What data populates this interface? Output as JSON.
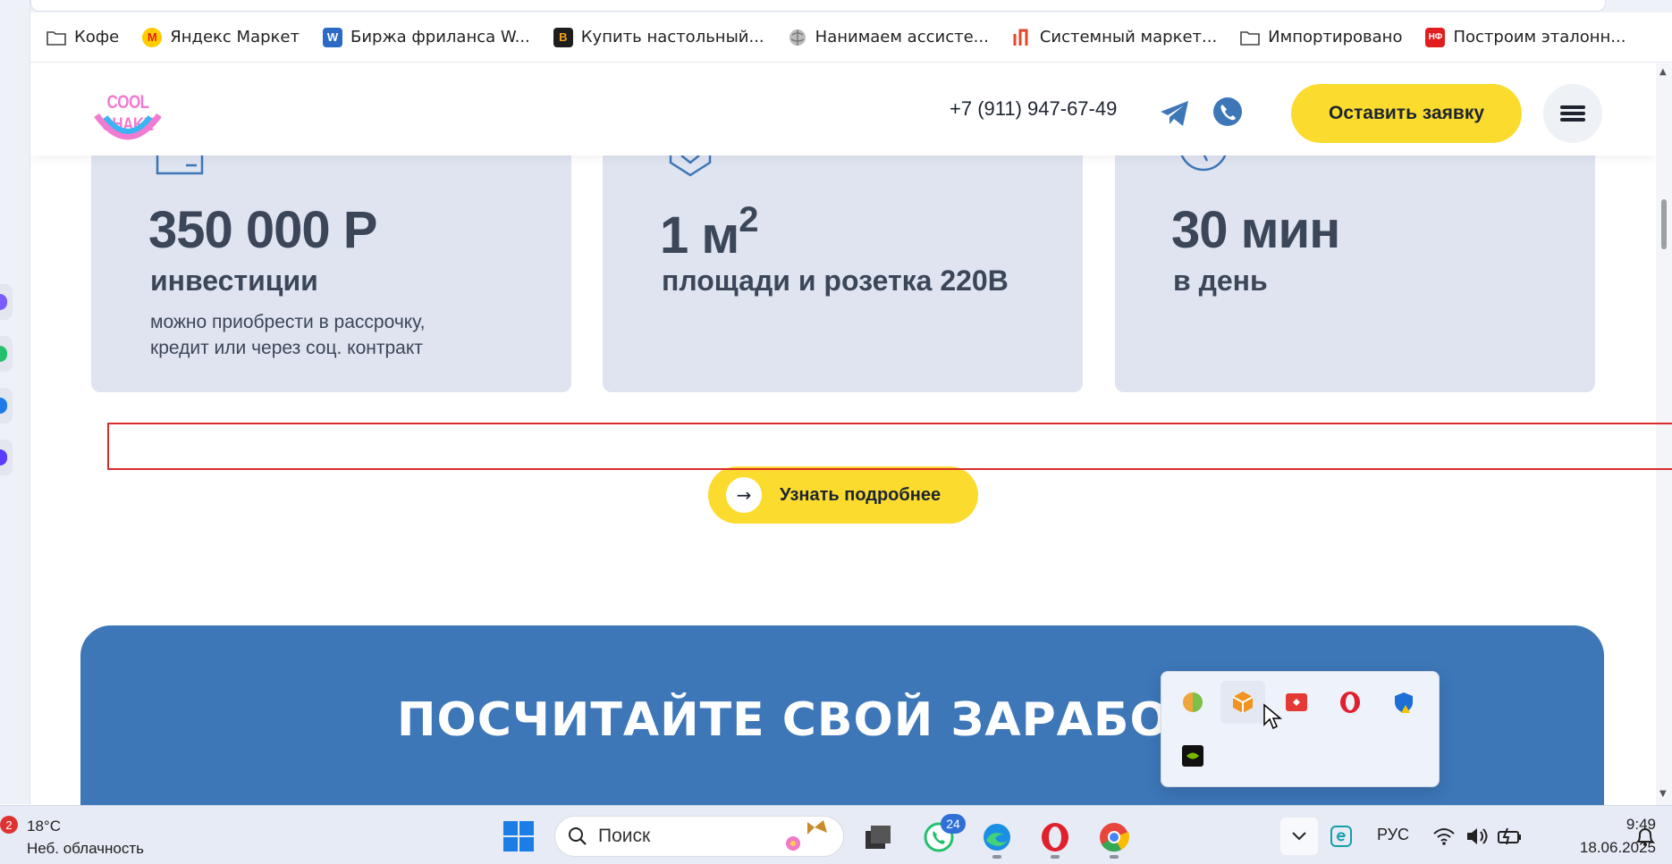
{
  "bookmarks": [
    {
      "label": "Кофе",
      "icon": "folder-icon"
    },
    {
      "label": "Яндекс Маркет",
      "icon": "yandex-market-icon"
    },
    {
      "label": "Биржа фриланса W...",
      "icon": "w-icon"
    },
    {
      "label": "Купить настольный...",
      "icon": "b-icon"
    },
    {
      "label": "Нанимаем ассисте...",
      "icon": "globe-icon"
    },
    {
      "label": "Системный маркет...",
      "icon": "market-icon"
    },
    {
      "label": "Импортировано",
      "icon": "folder-icon"
    },
    {
      "label": "Построим эталонн...",
      "icon": "nf-icon"
    }
  ],
  "header": {
    "logo_text": "COOL SHAKE",
    "phone": "+7 (911) 947-67-49",
    "cta_label": "Оставить заявку"
  },
  "stats": [
    {
      "value": "350 000 Р",
      "sub": "инвестиции",
      "note_line1": "можно приобрести в рассрочку,",
      "note_line2": "кредит или через соц. контракт",
      "icon": "wallet-icon"
    },
    {
      "value": "1 м",
      "sup": "2",
      "sub": "площади и розетка 220В",
      "icon": "box-icon"
    },
    {
      "value": "30 мин",
      "sub": "в день",
      "icon": "clock-icon"
    }
  ],
  "learn_more_label": "Узнать подробнее",
  "calc_title": "ПОСЧИТАЙТЕ СВОЙ ЗАРАБОТО",
  "taskbar": {
    "weather_badge": "2",
    "weather_temp": "18°C",
    "weather_desc": "Неб. облачность",
    "search_placeholder": "Поиск",
    "whatsapp_badge": "24",
    "lang": "РУС",
    "time": "9:49",
    "date": "18.06.2025"
  },
  "colors": {
    "accent_yellow": "#fbdc2e",
    "calc_blue": "#3d77b8",
    "card_bg": "#dfe4f0",
    "highlight_red": "#d92b2b"
  }
}
